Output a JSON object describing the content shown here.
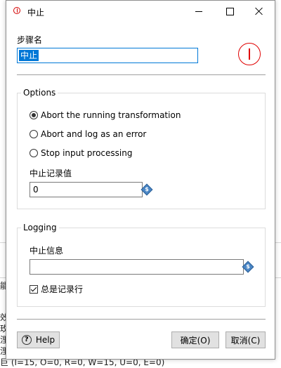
{
  "window": {
    "title": "中止"
  },
  "step_name": {
    "label": "步骤名",
    "value": "中止"
  },
  "options": {
    "title": "Options",
    "radios": [
      {
        "label": "Abort the running transformation",
        "selected": true
      },
      {
        "label": "Abort and log as an error",
        "selected": false
      },
      {
        "label": "Stop input processing",
        "selected": false
      }
    ],
    "threshold_label": "中止记录值",
    "threshold_value": "0"
  },
  "logging": {
    "title": "Logging",
    "message_label": "中止信息",
    "message_value": "",
    "always_log_label": "总是记录行",
    "always_log_checked": true
  },
  "buttons": {
    "help": "Help",
    "ok": "确定(O)",
    "cancel": "取消(C)"
  },
  "background": {
    "lines": [
      "能",
      "效",
      "玫",
      "浬",
      "浬",
      "巨 (I=15, O=0, R=0, W=15, U=0, E=0)"
    ]
  },
  "colors": {
    "accent": "#0078d7",
    "error_icon": "#e00000"
  }
}
